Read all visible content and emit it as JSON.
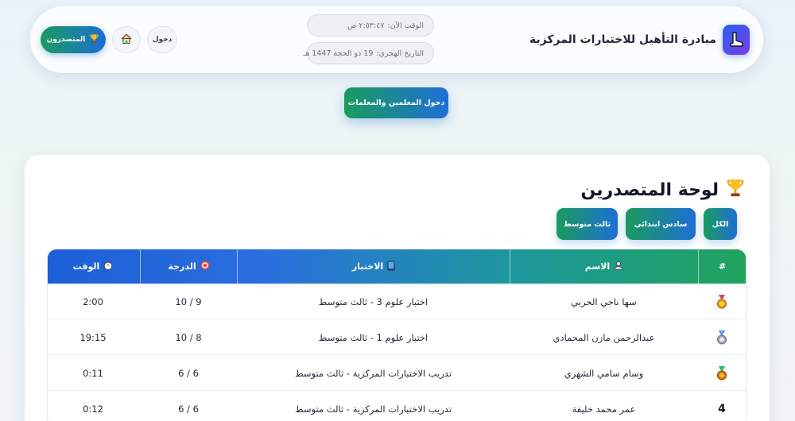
{
  "header": {
    "brand_title": "مبادرة التأهيل للاختبارات المركزية",
    "time_label": "الوقت الآن:",
    "time_value": "٢:٥٣:٤٧ ص",
    "date_label": "التاريخ الهجري:",
    "date_value": "19 ذو الحجة 1447 هـ",
    "login_label": "دخول",
    "top_label": "المتصدرون",
    "colors": {
      "accent_start": "#1a9b5e",
      "accent_end": "#1d6fd6"
    }
  },
  "teachers_button": "دخول المعلمين والمعلمات",
  "board": {
    "title": "لوحة المتصدرين",
    "filters": [
      "الكل",
      "سادس ابتدائي",
      "ثالث متوسط"
    ],
    "columns": {
      "rank": "#",
      "name": "الاسم",
      "exam": "الاختبار",
      "score": "الدرجة",
      "time": "الوقت"
    },
    "rows": [
      {
        "rank": "gold-medal",
        "name": "سها ناجي الحربي",
        "exam": "اختبار علوم 3 - ثالث متوسط",
        "score": "9 / 10",
        "time": "2:00"
      },
      {
        "rank": "silver-medal",
        "name": "عبدالرحمن مازن المحمادي",
        "exam": "اختبار علوم 1 - ثالث متوسط",
        "score": "8 / 10",
        "time": "19:15"
      },
      {
        "rank": "bronze-medal",
        "name": "وسام سامي الشهري",
        "exam": "تدريب الاختبارات المركزية - ثالث متوسط",
        "score": "6 / 6",
        "time": "0:11"
      },
      {
        "rank": "4",
        "name": "عمر محمد خليفة",
        "exam": "تدريب الاختبارات المركزية - ثالث متوسط",
        "score": "6 / 6",
        "time": "0:12"
      }
    ]
  }
}
